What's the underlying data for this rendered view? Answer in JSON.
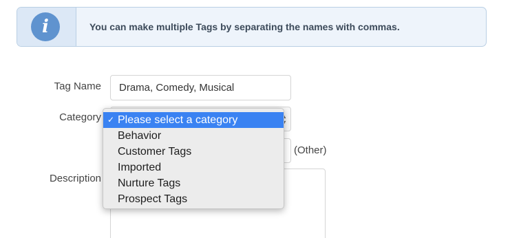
{
  "info": {
    "icon": "info-icon",
    "icon_glyph": "i",
    "message": "You can make multiple Tags by separating the names with commas."
  },
  "form": {
    "tag_name_label": "Tag Name",
    "tag_name_value": "Drama, Comedy, Musical",
    "category_label": "Category",
    "other_suffix": "(Other)",
    "description_label": "Description"
  },
  "category_dropdown": {
    "selected_check": "✓",
    "options": [
      "Please select a category",
      "Behavior",
      "Customer Tags",
      "Imported",
      "Nurture Tags",
      "Prospect Tags"
    ],
    "selected_index": 0
  },
  "colors": {
    "accent": "#3a82f2",
    "info_icon": "#5f93cf",
    "info_background": "#eef4fb"
  }
}
